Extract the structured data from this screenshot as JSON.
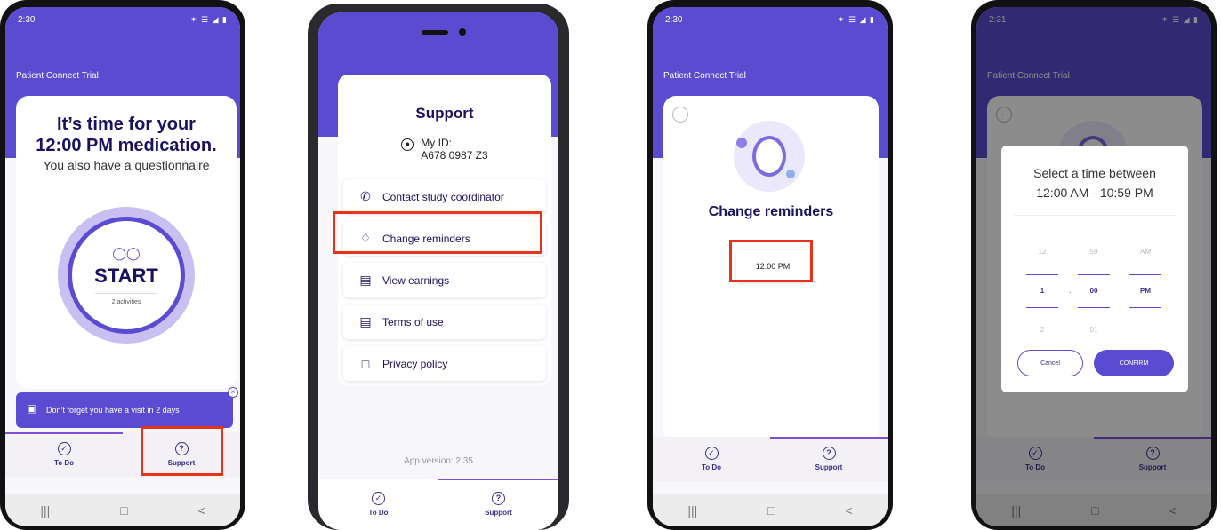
{
  "phone1": {
    "status_time": "2:30",
    "status_icons": "☰ ■",
    "status_right": "✶ ☰ ◢ ▮",
    "app_title": "Patient Connect Trial",
    "headline_line1": "It’s time for your",
    "headline_line2": "12:00 PM medication.",
    "subline": "You also have a questionnaire",
    "start_label": "START",
    "start_activities": "2 activities",
    "banner_text": "Don’t forget you have a visit in 2 days",
    "nav_todo": "To Do",
    "nav_support": "Support"
  },
  "phone2": {
    "title": "Support",
    "my_id_label": "My ID:",
    "my_id_value": "A678 0987 Z3",
    "menu": [
      {
        "label": "Contact study coordinator",
        "icon": "phone-icon"
      },
      {
        "label": "Change reminders",
        "icon": "bell-icon"
      },
      {
        "label": "View earnings",
        "icon": "card-icon"
      },
      {
        "label": "Terms of use",
        "icon": "document-icon"
      },
      {
        "label": "Privacy policy",
        "icon": "lock-icon"
      }
    ],
    "app_version": "App version: 2.35",
    "nav_todo": "To Do",
    "nav_support": "Support"
  },
  "phone3": {
    "status_time": "2:30",
    "app_title": "Patient Connect Trial",
    "title": "Change reminders",
    "reminder_time": "12:00 PM",
    "nav_todo": "To Do",
    "nav_support": "Support"
  },
  "phone4": {
    "status_time": "2:31",
    "app_title": "Patient Connect Trial",
    "dialog_line1": "Select a time between",
    "dialog_line2": "12:00 AM - 10:59 PM",
    "hours": [
      "12",
      "1",
      "2"
    ],
    "minutes": [
      "59",
      "00",
      "01"
    ],
    "ampm": [
      "AM",
      "PM"
    ],
    "colon": ":",
    "cancel": "Cancel",
    "confirm": "CONFIRM",
    "nav_todo": "To Do",
    "nav_support": "Support"
  },
  "colors": {
    "primary": "#5b4bd1",
    "dark_text": "#1a1160",
    "highlight": "#e8331c"
  }
}
